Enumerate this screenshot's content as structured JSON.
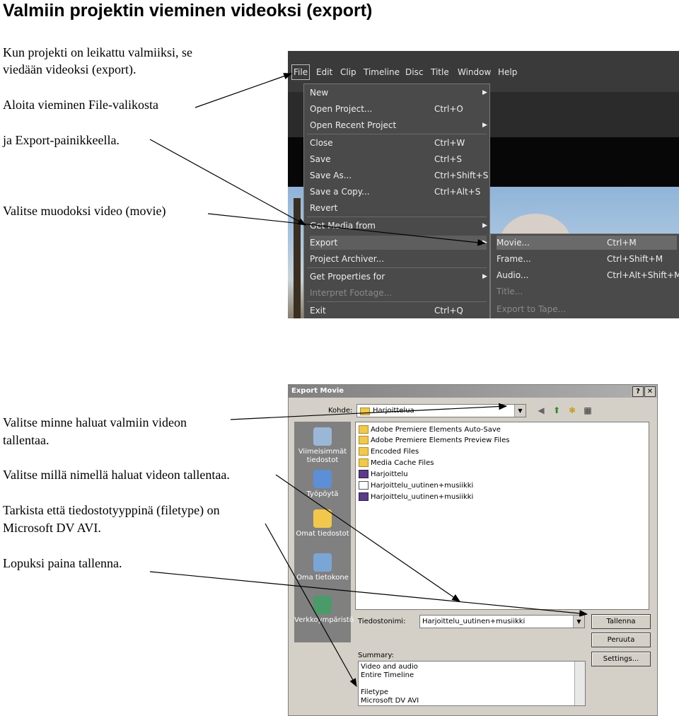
{
  "page": {
    "title": "Valmiin projektin vieminen videoksi (export)",
    "paragraphs": [
      "Kun projekti on leikattu valmiiksi, se",
      "viedään videoksi (export).",
      "Aloita vieminen File-valikosta",
      "ja Export-painikkeella.",
      "Valitse muodoksi video (movie)",
      "Valitse minne haluat valmiin videon",
      "tallentaa.",
      "Valitse millä nimellä haluat videon tallentaa.",
      "Tarkista että tiedostotyyppinä (filetype) on",
      "Microsoft DV AVI.",
      "Lopuksi paina tallenna."
    ]
  },
  "premiere": {
    "menubar": [
      "File",
      "Edit",
      "Clip",
      "Timeline",
      "Disc",
      "Title",
      "Window",
      "Help"
    ],
    "file_menu": [
      {
        "label": "New",
        "shortcut": "",
        "submenu": true,
        "disabled": false
      },
      {
        "label": "Open Project...",
        "shortcut": "Ctrl+O",
        "submenu": false,
        "disabled": false
      },
      {
        "label": "Open Recent Project",
        "shortcut": "",
        "submenu": true,
        "disabled": false
      },
      {
        "label": "Close",
        "shortcut": "Ctrl+W",
        "submenu": false,
        "disabled": false
      },
      {
        "label": "Save",
        "shortcut": "Ctrl+S",
        "submenu": false,
        "disabled": false
      },
      {
        "label": "Save As...",
        "shortcut": "Ctrl+Shift+S",
        "submenu": false,
        "disabled": false
      },
      {
        "label": "Save a Copy...",
        "shortcut": "Ctrl+Alt+S",
        "submenu": false,
        "disabled": false
      },
      {
        "label": "Revert",
        "shortcut": "",
        "submenu": false,
        "disabled": false
      },
      {
        "label": "Get Media from",
        "shortcut": "",
        "submenu": true,
        "disabled": false
      },
      {
        "label": "Export",
        "shortcut": "",
        "submenu": true,
        "disabled": false
      },
      {
        "label": "Project Archiver...",
        "shortcut": "",
        "submenu": false,
        "disabled": false
      },
      {
        "label": "Get Properties for",
        "shortcut": "",
        "submenu": true,
        "disabled": false
      },
      {
        "label": "Interpret Footage...",
        "shortcut": "",
        "submenu": false,
        "disabled": true
      },
      {
        "label": "Exit",
        "shortcut": "Ctrl+Q",
        "submenu": false,
        "disabled": false
      }
    ],
    "export_submenu": [
      {
        "label": "Movie...",
        "shortcut": "Ctrl+M",
        "disabled": false
      },
      {
        "label": "Frame...",
        "shortcut": "Ctrl+Shift+M",
        "disabled": false
      },
      {
        "label": "Audio...",
        "shortcut": "Ctrl+Alt+Shift+M",
        "disabled": false
      },
      {
        "label": "Title...",
        "shortcut": "",
        "disabled": true
      },
      {
        "label": "Export to Tape...",
        "shortcut": "",
        "disabled": true
      }
    ]
  },
  "dialog": {
    "title": "Export Movie",
    "help_btn": "?",
    "close_btn": "✕",
    "kohde_label": "Kohde:",
    "kohde_value": "Harjoittelua",
    "places": [
      "Viimeisimmät tiedostot",
      "Työpöytä",
      "Omat tiedostot",
      "Oma tietokone",
      "Verkkoympäristö"
    ],
    "files": [
      {
        "name": "Adobe Premiere Elements Auto-Save",
        "type": "folder"
      },
      {
        "name": "Adobe Premiere Elements Preview Files",
        "type": "folder"
      },
      {
        "name": "Encoded Files",
        "type": "folder"
      },
      {
        "name": "Media Cache Files",
        "type": "folder"
      },
      {
        "name": "Harjoittelu",
        "type": "proj"
      },
      {
        "name": "Harjoittelu_uutinen+musiikki",
        "type": "doc"
      },
      {
        "name": "Harjoittelu_uutinen+musiikki",
        "type": "proj"
      }
    ],
    "filename_label": "Tiedostonimi:",
    "filename_value": "Harjoittelu_uutinen+musiikki",
    "buttons": {
      "save": "Tallenna",
      "cancel": "Peruuta",
      "settings": "Settings..."
    },
    "summary_label": "Summary:",
    "summary_lines": [
      "Video and audio",
      "Entire Timeline",
      "",
      "Filetype",
      "Microsoft DV AVI"
    ],
    "icons": {
      "back": "back-icon",
      "up": "up-folder-icon",
      "new": "new-folder-icon",
      "view": "view-menu-icon"
    }
  }
}
